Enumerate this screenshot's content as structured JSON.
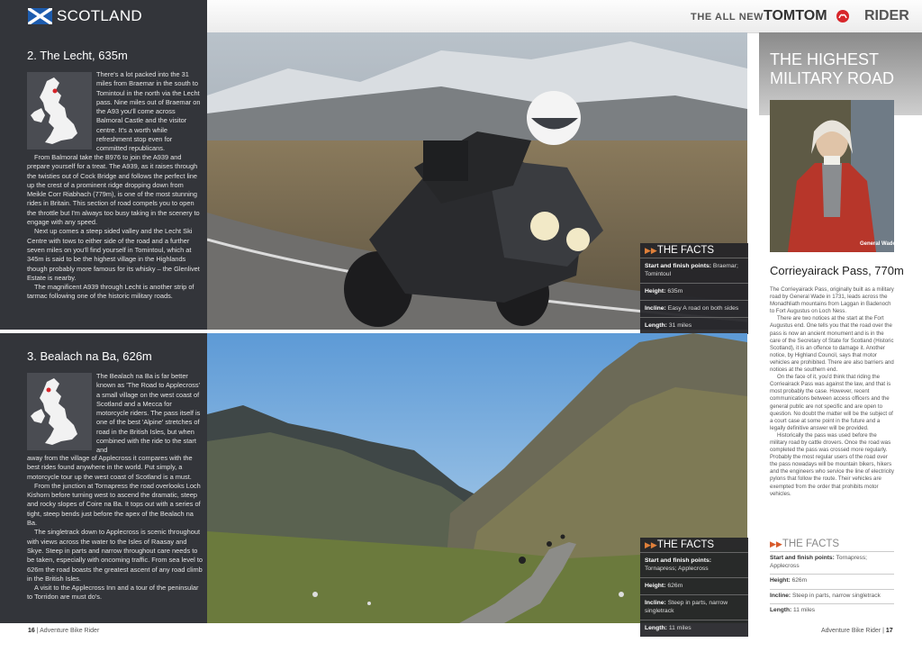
{
  "header": {
    "section": "SCOTLAND",
    "tagline": "THE ALL NEW",
    "brand_a": "TOMTOM",
    "brand_b": "RIDER"
  },
  "route1": {
    "title": "2. The Lecht, 635m",
    "intro": "There's a lot packed into the 31 miles from Braemar in the south to Tomintoul in the north via the Lecht pass. Nine miles out of Braemar on the A93 you'll come across Balmoral Castle and the visitor centre. It's a worth while refreshment stop even for committed republicans.",
    "paragraphs": [
      "From Balmoral take the B976 to join the A939 and prepare yourself for a treat. The A939, as it raises through the twisties out of Cock Bridge and follows the perfect line up the crest of a prominent ridge dropping down from Meikle Corr Riabhach (779m), is one of the most stunning rides in Britain. This section of road compels you to open the throttle but I'm always too busy taking in the scenery to engage with any speed.",
      "Next up comes a steep sided valley and the Lecht Ski Centre with tows to either side of the road and a further seven miles on you'll find yourself in Tomintoul, which at 345m is said to be the highest village in the Highlands though probably more famous for its whisky – the Glenlivet Estate is nearby.",
      "The magnificent A939 through Lecht is another strip of tarmac following one of the historic military roads."
    ],
    "facts": {
      "heading": "THE FACTS",
      "start_label": "Start and finish points:",
      "start_value": "Braemar; Tomintoul",
      "height_label": "Height:",
      "height_value": "635m",
      "incline_label": "Incline:",
      "incline_value": "Easy A road on both sides",
      "length_label": "Length:",
      "length_value": "31 miles"
    }
  },
  "route2": {
    "title": "3. Bealach na Ba, 626m",
    "intro": "The Bealach na Ba is far better known as 'The Road to Applecross' a small village on the west coast of Scotland and a Mecca for motorcycle riders. The pass itself is one of the best 'Alpine' stretches of road in the British Isles, but when combined with the ride to the start and",
    "paragraphs": [
      "away from the village of Applecross it compares with the best rides found anywhere in the world. Put simply, a motorcycle tour up the west coast of Scotland is a must.",
      "From the junction at Tornapress the road overlooks Loch Kishorn before turning west to ascend the dramatic, steep and rocky slopes of Coire na Ba. It tops out with a series of tight, steep bends just before the apex of the Bealach na Ba.",
      "The singletrack down to Applecross is scenic throughout with views across the water to the Isles of Raasay and Skye. Steep in parts and narrow throughout care needs to be taken, especially with oncoming traffic. From sea level to 626m the road boasts the greatest ascent of any road climb in the British Isles.",
      "A visit to the Applecross Inn and a tour of the peninsular to Torridon are must do's."
    ],
    "facts": {
      "heading": "THE FACTS",
      "start_label": "Start and finish points:",
      "start_value": "Tornapress; Applecross",
      "height_label": "Height:",
      "height_value": "626m",
      "incline_label": "Incline:",
      "incline_value": "Steep in parts, narrow singletrack",
      "length_label": "Length:",
      "length_value": "11 miles"
    }
  },
  "sidebar": {
    "title": "THE HIGHEST MILITARY ROAD",
    "caption": "General Wade",
    "subtitle": "Corrieyairack Pass, 770m",
    "paragraphs": [
      "The Corrieyairack Pass, originally built as a military road by General Wade in 1731, leads across the Monadhliath mountains from Laggan in Badenoch to Fort Augustus on Loch Ness.",
      "There are two notices at the start at the Fort Augustus end. One tells you that the road over the pass is now an ancient monument and is in the care of the Secretary of State for Scotland (Historic Scotland), it is an offence to damage it. Another notice, by Highland Council, says that motor vehicles are prohibited. There are also barriers and notices at the southern end.",
      "On the face of it, you'd think that riding the Corrieairack Pass was against the law, and that is most probably the case. However, recent communications between access officers and the general public are not specific and are open to question. No doubt the matter will be the subject of a court case at some point in the future and a legally definitive answer will be provided.",
      "Historically the pass was used before the military road by cattle drovers. Once the road was completed the pass was crossed more regularly. Probably the most regular users of the road over the pass nowadays will be mountain bikers, hikers and the engineers who service the line of electricity pylons that follow the route. Their vehicles are exempted from the order that prohibits motor vehicles."
    ],
    "facts": {
      "heading": "THE FACTS",
      "start_label": "Start and finish points:",
      "start_value": "Tornapress; Applecross",
      "height_label": "Height:",
      "height_value": "626m",
      "incline_label": "Incline:",
      "incline_value": "Steep in parts, narrow singletrack",
      "length_label": "Length:",
      "length_value": "11 miles"
    }
  },
  "footer": {
    "left_page": "16",
    "left_sep": "|",
    "left_mag": "Adventure Bike Rider",
    "right_mag": "Adventure Bike Rider",
    "right_sep": "|",
    "right_page": "17"
  },
  "colors": {
    "accent_orange": "#e0803a",
    "dark_panel": "#33353a",
    "flag_blue": "#1d5cae"
  }
}
